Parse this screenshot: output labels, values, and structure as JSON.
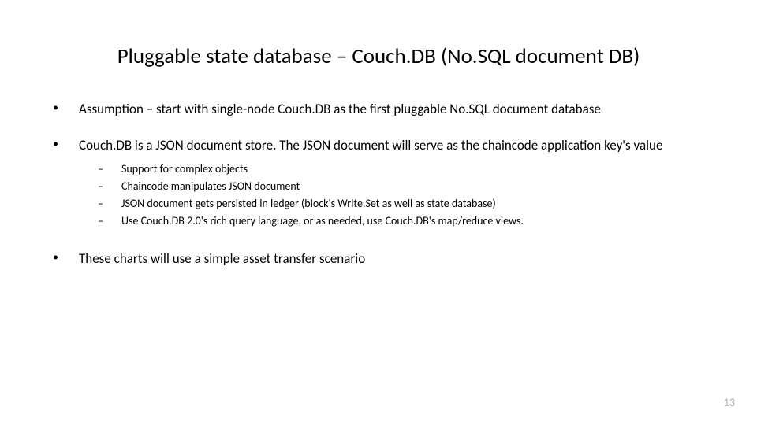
{
  "slide": {
    "title": "Pluggable state database – Couch.DB (No.SQL document DB)",
    "bullets": [
      {
        "marker": "•",
        "text": "Assumption – start with single-node Couch.DB as the first pluggable No.SQL document database",
        "subs": []
      },
      {
        "marker": "•",
        "text": "Couch.DB is a JSON document store.  The JSON document will serve as the chaincode application key's value",
        "subs": [
          {
            "marker": "–",
            "text": "Support for complex objects"
          },
          {
            "marker": "–",
            "text": "Chaincode manipulates JSON document"
          },
          {
            "marker": "–",
            "text": "JSON document gets persisted in ledger (block's Write.Set as well as state database)"
          },
          {
            "marker": "–",
            "text": "Use Couch.DB 2.0's rich query language, or as needed, use Couch.DB's map/reduce views."
          }
        ]
      },
      {
        "marker": "•",
        "text": "These charts will use a simple asset transfer scenario",
        "subs": []
      }
    ],
    "page_number": "13"
  }
}
